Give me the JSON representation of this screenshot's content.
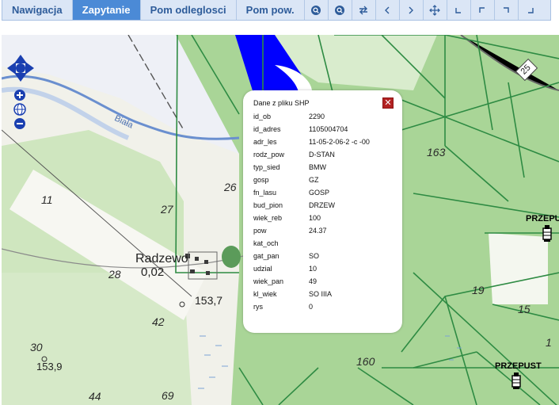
{
  "toolbar": {
    "tabs": [
      {
        "label": "Nawigacja",
        "active": false
      },
      {
        "label": "Zapytanie",
        "active": true
      },
      {
        "label": "Pom odleglosci",
        "active": false
      },
      {
        "label": "Pom pow.",
        "active": false
      }
    ],
    "buttons": [
      "zoom-in-icon",
      "zoom-out-icon",
      "swap-icon",
      "arrow-left-icon",
      "arrow-right-icon",
      "crosshair-icon",
      "corner-bottom-left-icon",
      "corner-top-left-icon",
      "corner-top-right-icon",
      "corner-bottom-right-icon"
    ]
  },
  "map": {
    "place_name": "Radzewo",
    "place_value": "0,02",
    "river": "Biała",
    "spot_heights": [
      "153,7",
      "153,9"
    ],
    "road_number": "25",
    "parcel_numbers": [
      "11",
      "27",
      "26",
      "28",
      "42",
      "30",
      "44",
      "69",
      "163",
      "19",
      "15",
      "160",
      "1"
    ],
    "przepust_labels": [
      "PRZEPU",
      "PRZEPUST"
    ],
    "colors": {
      "forest": "#a8d495",
      "lines": "#2e8b43",
      "water": "#0000ff"
    }
  },
  "popup": {
    "title": "Dane z pliku SHP",
    "close": "✕",
    "rows": [
      {
        "key": "id_ob",
        "value": "2290"
      },
      {
        "key": "id_adres",
        "value": "1105004704"
      },
      {
        "key": "adr_les",
        "value": "11-05-2-06-2 -c -00"
      },
      {
        "key": "rodz_pow",
        "value": "D-STAN"
      },
      {
        "key": "typ_sied",
        "value": "BMW"
      },
      {
        "key": "gosp",
        "value": "GZ"
      },
      {
        "key": "fn_lasu",
        "value": "GOSP"
      },
      {
        "key": "bud_pion",
        "value": "DRZEW"
      },
      {
        "key": "wiek_reb",
        "value": "100"
      },
      {
        "key": "pow",
        "value": "24.37"
      },
      {
        "key": "kat_och",
        "value": ""
      },
      {
        "key": "gat_pan",
        "value": "SO"
      },
      {
        "key": "udzial",
        "value": "10"
      },
      {
        "key": "wiek_pan",
        "value": "49"
      },
      {
        "key": "kl_wiek",
        "value": "SO IIIA"
      },
      {
        "key": "rys",
        "value": "0"
      }
    ]
  }
}
